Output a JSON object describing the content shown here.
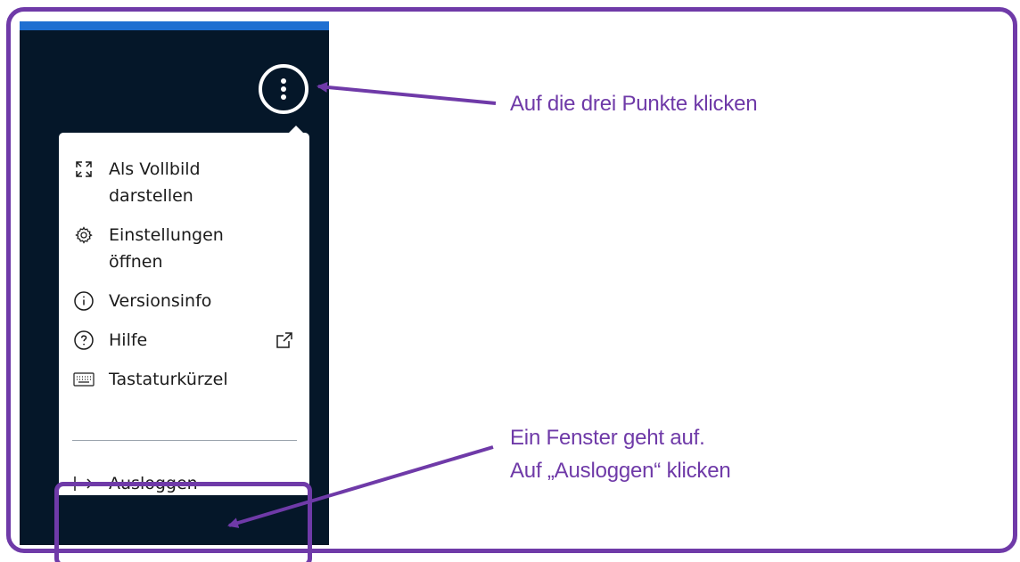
{
  "menu": {
    "items": [
      {
        "icon": "fullscreen-icon",
        "label": "Als Vollbild\ndarstellen",
        "trailing_icon": ""
      },
      {
        "icon": "gear-icon",
        "label": "Einstellungen\nöffnen",
        "trailing_icon": ""
      },
      {
        "icon": "info-icon",
        "label": "Versionsinfo",
        "trailing_icon": ""
      },
      {
        "icon": "help-icon",
        "label": "Hilfe",
        "trailing_icon": "external-link-icon"
      },
      {
        "icon": "keyboard-icon",
        "label": "Tastaturkürzel",
        "trailing_icon": ""
      }
    ],
    "logout": {
      "icon": "logout-icon",
      "label": "Ausloggen"
    }
  },
  "annotations": {
    "callout_1": "Auf die drei Punkte klicken",
    "callout_2_line_1": "Ein Fenster geht auf.",
    "callout_2_line_2": "Auf „Ausloggen“ klicken"
  },
  "colors": {
    "accent": "#6f3aa8",
    "panel": "#051729",
    "top_strip": "#1f6fd1",
    "menu_bg": "#ffffff"
  }
}
